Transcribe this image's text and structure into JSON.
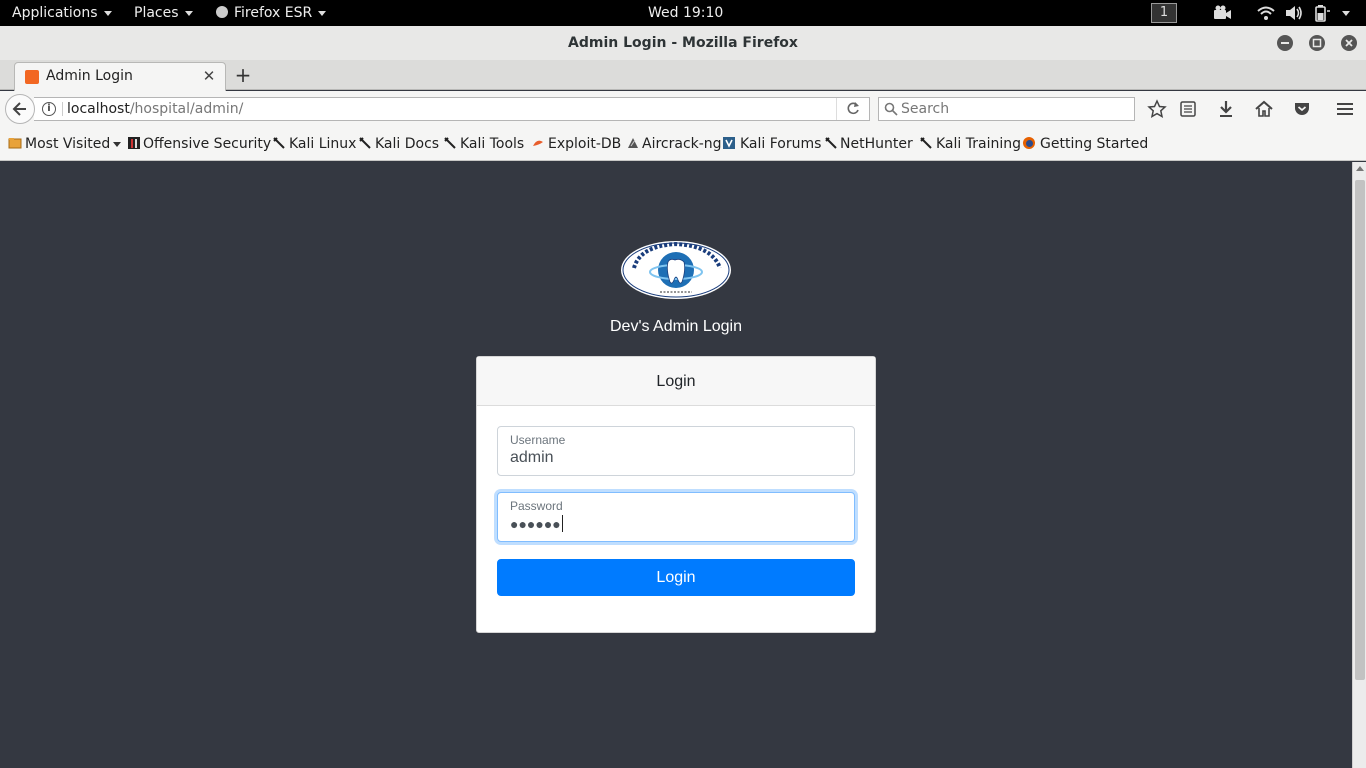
{
  "system_bar": {
    "applications": "Applications",
    "places": "Places",
    "app_name": "Firefox ESR",
    "clock": "Wed 19:10",
    "workspace": "1"
  },
  "window": {
    "title": "Admin Login - Mozilla Firefox"
  },
  "tabs": [
    {
      "label": "Admin Login"
    }
  ],
  "navbar": {
    "url_host": "localhost",
    "url_path": "/hospital/admin/",
    "search_placeholder": "Search"
  },
  "bookmarks": [
    {
      "label": "Most Visited",
      "icon": "folder-icon"
    },
    {
      "label": "Offensive Security",
      "icon": "offsec-icon"
    },
    {
      "label": "Kali Linux",
      "icon": "kali-icon"
    },
    {
      "label": "Kali Docs",
      "icon": "kali-icon"
    },
    {
      "label": "Kali Tools",
      "icon": "kali-icon"
    },
    {
      "label": "Exploit-DB",
      "icon": "exploitdb-icon"
    },
    {
      "label": "Aircrack-ng",
      "icon": "aircrack-icon"
    },
    {
      "label": "Kali Forums",
      "icon": "forums-icon"
    },
    {
      "label": "NetHunter",
      "icon": "kali-icon"
    },
    {
      "label": "Kali Training",
      "icon": "kali-icon"
    },
    {
      "label": "Getting Started",
      "icon": "firefox-icon"
    }
  ],
  "page": {
    "heading": "Dev's Admin Login",
    "card_title": "Login",
    "username_label": "Username",
    "username_value": "admin",
    "password_label": "Password",
    "password_value": "●●●●●●",
    "login_button": "Login"
  },
  "colors": {
    "page_background": "#343841",
    "primary_button": "#007bff"
  }
}
